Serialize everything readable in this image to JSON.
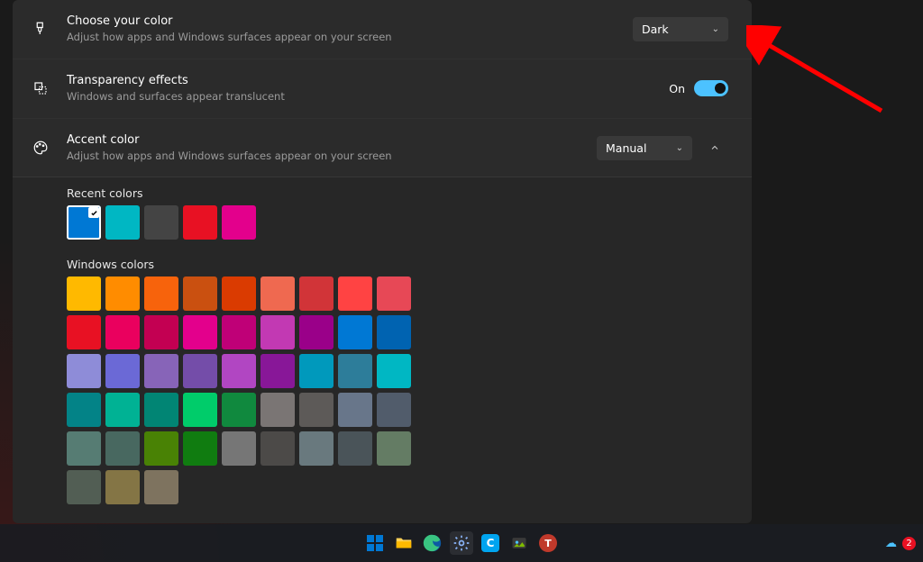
{
  "choose_color": {
    "title": "Choose your color",
    "sub": "Adjust how apps and Windows surfaces appear on your screen",
    "value": "Dark"
  },
  "transparency": {
    "title": "Transparency effects",
    "sub": "Windows and surfaces appear translucent",
    "state_label": "On",
    "on": true
  },
  "accent": {
    "title": "Accent color",
    "sub": "Adjust how apps and Windows surfaces appear on your screen",
    "mode": "Manual"
  },
  "recent_colors": {
    "label": "Recent colors",
    "colors": [
      "#0078d4",
      "#00b7c3",
      "#444444",
      "#e81123",
      "#e3008c"
    ],
    "selected_index": 0
  },
  "windows_colors": {
    "label": "Windows colors",
    "colors": [
      "#ffb900",
      "#ff8c00",
      "#f7630c",
      "#ca5010",
      "#da3b01",
      "#ef6950",
      "#d13438",
      "#ff4343",
      "#e74856",
      "#e81123",
      "#ea005e",
      "#c30052",
      "#e3008c",
      "#bf0077",
      "#c239b3",
      "#9a0089",
      "#0078d4",
      "#0063b1",
      "#8e8cd8",
      "#6b69d6",
      "#8764b8",
      "#744da9",
      "#b146c2",
      "#881798",
      "#0099bc",
      "#2d7d9a",
      "#00b7c3",
      "#038387",
      "#00b294",
      "#018574",
      "#00cc6a",
      "#10893e",
      "#7a7574",
      "#5d5a58",
      "#68768a",
      "#515c6b",
      "#567c73",
      "#486860",
      "#498205",
      "#107c10",
      "#767676",
      "#4c4a48",
      "#69797e",
      "#4a5459",
      "#647c64",
      "#525e54",
      "#847545",
      "#7e735f"
    ]
  },
  "taskbar": {
    "items": [
      "start",
      "file-explorer",
      "edge",
      "settings",
      "cortana",
      "photos",
      "teamviewer"
    ],
    "badge_count": "2"
  }
}
